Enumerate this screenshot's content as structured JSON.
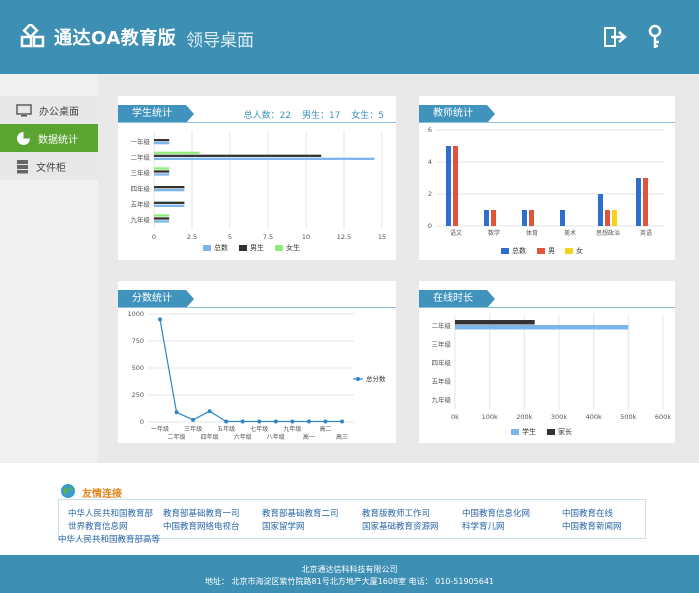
{
  "header": {
    "title": "通达OA教育版",
    "subtitle": "领导桌面",
    "icons": [
      "logout-icon",
      "key-icon"
    ]
  },
  "sidebar": {
    "items": [
      {
        "label": "办公桌面",
        "icon": "monitor-icon",
        "active": false
      },
      {
        "label": "数据统计",
        "icon": "pie-chart-icon",
        "active": true
      },
      {
        "label": "文件柜",
        "icon": "cabinet-icon",
        "active": false
      }
    ]
  },
  "panels": {
    "student": {
      "title": "学生统计",
      "summary": {
        "total": "总人数：22",
        "male": "男生：17",
        "female": "女生：5"
      }
    },
    "teacher": {
      "title": "教师统计"
    },
    "score": {
      "title": "分数统计"
    },
    "online": {
      "title": "在线时长"
    }
  },
  "chart_data": [
    {
      "type": "bar",
      "orientation": "horizontal",
      "categories": [
        "一年级",
        "二年级",
        "三年级",
        "四年级",
        "五年级",
        "九年级"
      ],
      "series": [
        {
          "name": "总数",
          "values": [
            1,
            14.5,
            1,
            2,
            2,
            1
          ],
          "color": "#7cb5ec"
        },
        {
          "name": "男生",
          "values": [
            1,
            11,
            1,
            2,
            2,
            1
          ],
          "color": "#333333"
        },
        {
          "name": "女生",
          "values": [
            0,
            3,
            1,
            0,
            0,
            1
          ],
          "color": "#90ed7d"
        }
      ],
      "xlim": [
        0,
        15
      ],
      "xticks": [
        "0",
        "2.5",
        "5",
        "7.5",
        "10",
        "12.5",
        "15"
      ],
      "legend": "bottom"
    },
    {
      "type": "bar",
      "categories": [
        "语文",
        "数学",
        "体育",
        "美术",
        "思想政治",
        "英语"
      ],
      "series": [
        {
          "name": "总数",
          "values": [
            5,
            1,
            1,
            1,
            2,
            3
          ],
          "color": "#2f6fcb"
        },
        {
          "name": "男",
          "values": [
            5,
            1,
            1,
            0,
            1,
            3
          ],
          "color": "#e0553a"
        },
        {
          "name": "女",
          "values": [
            0,
            0,
            0,
            0,
            1,
            0
          ],
          "color": "#f5d31a"
        }
      ],
      "ylim": [
        0,
        6
      ],
      "yticks": [
        "0",
        "2",
        "4",
        "6"
      ],
      "legend": "bottom"
    },
    {
      "type": "line",
      "categories": [
        "一年级",
        "二年级",
        "三年级",
        "四年级",
        "五年级",
        "六年级",
        "七年级",
        "八年级",
        "九年级",
        "高一",
        "高二",
        "高三"
      ],
      "series": [
        {
          "name": "总分数",
          "values": [
            950,
            90,
            20,
            100,
            5,
            5,
            5,
            5,
            5,
            5,
            5,
            5
          ],
          "color": "#2f86c4"
        }
      ],
      "ylim": [
        0,
        1000
      ],
      "yticks": [
        "0",
        "250",
        "500",
        "750",
        "1000"
      ],
      "legend": "right"
    },
    {
      "type": "bar",
      "orientation": "horizontal",
      "categories": [
        "二年级",
        "三年级",
        "四年级",
        "五年级",
        "九年级"
      ],
      "series": [
        {
          "name": "学生",
          "values": [
            500000,
            0,
            0,
            0,
            0
          ],
          "color": "#7cb5ec"
        },
        {
          "name": "家长",
          "values": [
            230000,
            0,
            0,
            0,
            0
          ],
          "color": "#333333"
        }
      ],
      "xlim": [
        0,
        600000
      ],
      "xticks": [
        "0k",
        "100k",
        "200k",
        "300k",
        "400k",
        "500k",
        "600k"
      ],
      "legend": "bottom"
    }
  ],
  "friend_links": {
    "title": "友情连接",
    "links": [
      "中华人民共和国教育部",
      "教育部基础教育一司",
      "教育部基础教育二司",
      "教育版教师工作司",
      "中国教育信息化网",
      "中国教育在线",
      "世界教育信息网",
      "中国教育网络电视台",
      "国家留学网",
      "国家基础教育资源网",
      "科学育儿网",
      "中国教育新闻网",
      "中华人民共和国教育部高等"
    ]
  },
  "footer": {
    "company": "北京通达信科科技有限公司",
    "address": "地址：  北京市海淀区紫竹院路81号北方地产大厦1608室    电话：  010-51905641"
  }
}
